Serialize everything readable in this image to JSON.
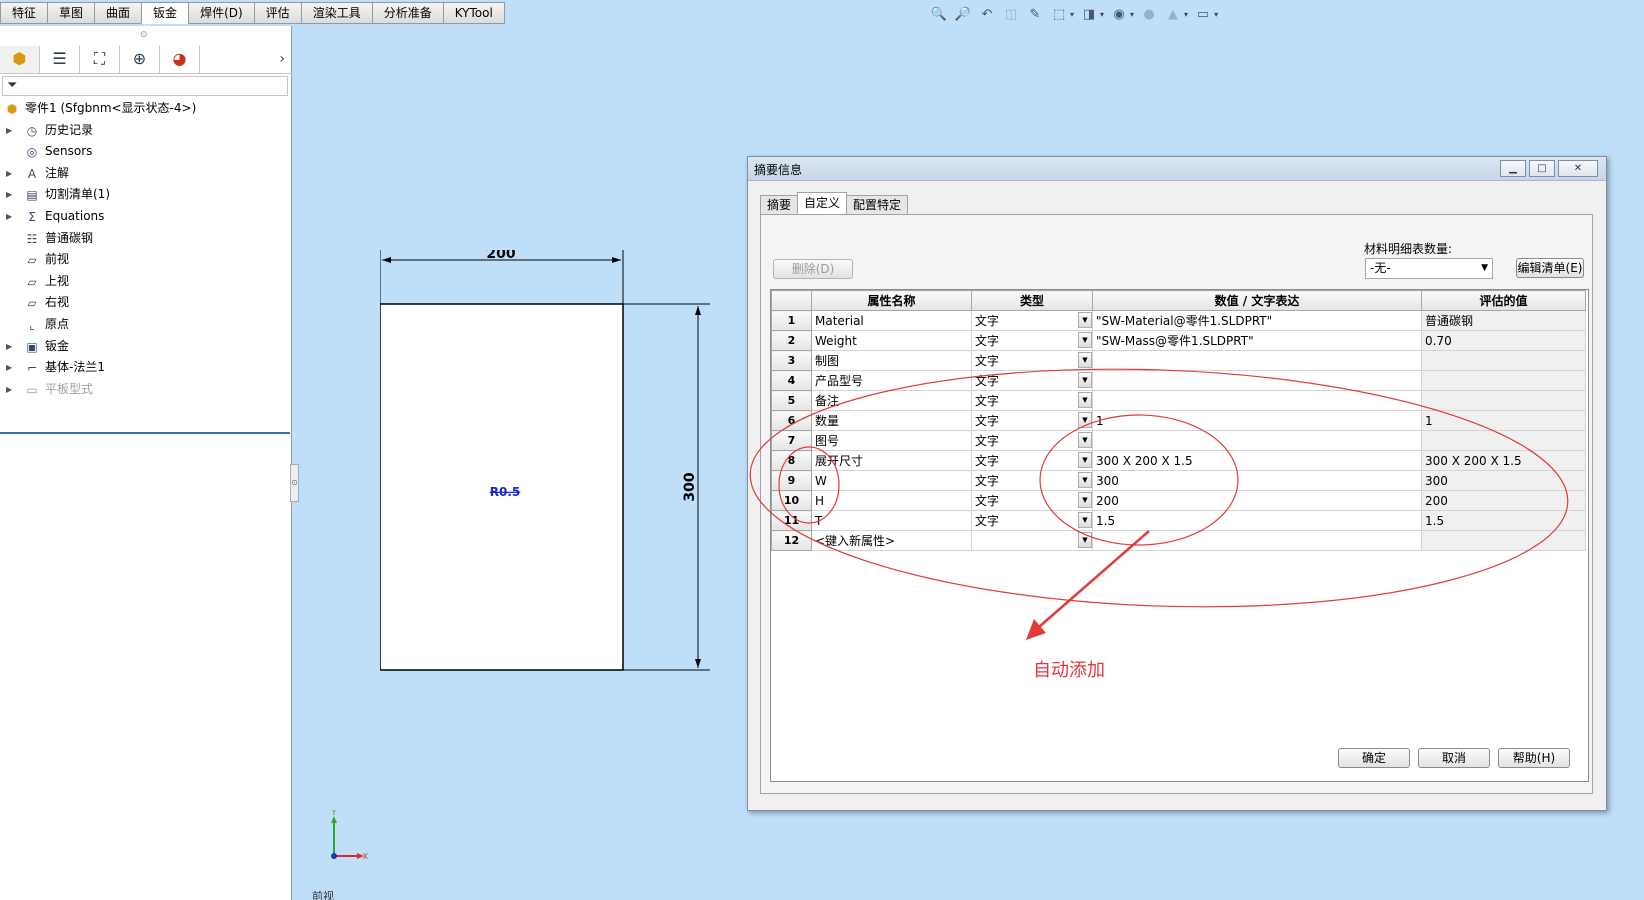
{
  "tabs": [
    "特征",
    "草图",
    "曲面",
    "钣金",
    "焊件(D)",
    "评估",
    "渲染工具",
    "分析准备",
    "KYTool"
  ],
  "active_tab": "钣金",
  "head_icons": [
    "zoom-to-fit-icon",
    "zoom-area-icon",
    "previous-view-icon",
    "section-view-icon",
    "dynamic-annotation-icon",
    "view-orientation-icon",
    "display-style-icon",
    "hide-show-icon",
    "appearance-icon",
    "scene-icon",
    "monitor-icon"
  ],
  "left_panel": {
    "tab_icons": [
      "feature-manager-icon",
      "property-manager-icon",
      "configuration-manager-icon",
      "dimxpert-icon",
      "display-manager-icon"
    ],
    "tree": [
      {
        "label": "零件1  (Sfgbnm<显示状态-4>)",
        "icon": "part-icon",
        "expandable": false,
        "indent": 0
      },
      {
        "label": "历史记录",
        "icon": "history-icon",
        "expandable": true,
        "indent": 1
      },
      {
        "label": "Sensors",
        "icon": "sensor-icon",
        "expandable": false,
        "indent": 1
      },
      {
        "label": "注解",
        "icon": "annotation-icon",
        "expandable": true,
        "indent": 1
      },
      {
        "label": "切割清单(1)",
        "icon": "cut-list-icon",
        "expandable": true,
        "indent": 1
      },
      {
        "label": "Equations",
        "icon": "equations-icon",
        "expandable": true,
        "indent": 1
      },
      {
        "label": "普通碳钢",
        "icon": "material-icon",
        "expandable": false,
        "indent": 1
      },
      {
        "label": "前视",
        "icon": "plane-icon",
        "expandable": false,
        "indent": 1
      },
      {
        "label": "上视",
        "icon": "plane-icon",
        "expandable": false,
        "indent": 1
      },
      {
        "label": "右视",
        "icon": "plane-icon",
        "expandable": false,
        "indent": 1
      },
      {
        "label": "原点",
        "icon": "origin-icon",
        "expandable": false,
        "indent": 1
      },
      {
        "label": "钣金",
        "icon": "sheet-metal-icon",
        "expandable": true,
        "indent": 1
      },
      {
        "label": "基体-法兰1",
        "icon": "base-flange-icon",
        "expandable": true,
        "indent": 1
      },
      {
        "label": "平板型式",
        "icon": "flat-pattern-icon",
        "expandable": true,
        "indent": 1,
        "disabled": true
      }
    ]
  },
  "drawing": {
    "width_dim": "200",
    "height_dim": "300",
    "radius_note": "R0.5"
  },
  "triad": {
    "y": "Y",
    "x": "X"
  },
  "view_label": "前视",
  "dialog": {
    "title": "摘要信息",
    "tabs": [
      "摘要",
      "自定义",
      "配置特定"
    ],
    "active_tab": "自定义",
    "delete_button": "删除(D)",
    "bom_qty_label": "材料明细表数量:",
    "bom_qty_value": "-无-",
    "edit_list_button": "编辑清单(E)",
    "columns": [
      "",
      "属性名称",
      "类型",
      "数值 / 文字表达",
      "评估的值"
    ],
    "rows": [
      {
        "no": "1",
        "name": "Material",
        "type": "文字",
        "value": "\"SW-Material@零件1.SLDPRT\"",
        "evaluated": "普通碳钢"
      },
      {
        "no": "2",
        "name": "Weight",
        "type": "文字",
        "value": "\"SW-Mass@零件1.SLDPRT\"",
        "evaluated": "0.70"
      },
      {
        "no": "3",
        "name": "制图",
        "type": "文字",
        "value": "",
        "evaluated": ""
      },
      {
        "no": "4",
        "name": "产品型号",
        "type": "文字",
        "value": "",
        "evaluated": ""
      },
      {
        "no": "5",
        "name": "备注",
        "type": "文字",
        "value": "",
        "evaluated": ""
      },
      {
        "no": "6",
        "name": "数量",
        "type": "文字",
        "value": "1",
        "evaluated": "1"
      },
      {
        "no": "7",
        "name": "图号",
        "type": "文字",
        "value": "",
        "evaluated": ""
      },
      {
        "no": "8",
        "name": "展开尺寸",
        "type": "文字",
        "value": "300 X 200 X 1.5",
        "evaluated": "300 X 200 X 1.5"
      },
      {
        "no": "9",
        "name": "W",
        "type": "文字",
        "value": "300",
        "evaluated": "300"
      },
      {
        "no": "10",
        "name": "H",
        "type": "文字",
        "value": "200",
        "evaluated": "200"
      },
      {
        "no": "11",
        "name": "T",
        "type": "文字",
        "value": "1.5",
        "evaluated": "1.5"
      },
      {
        "no": "12",
        "name": "<键入新属性>",
        "type": "",
        "value": "",
        "evaluated": ""
      }
    ],
    "ok_button": "确定",
    "cancel_button": "取消",
    "help_button": "帮助(H)"
  },
  "annotation": {
    "text": "自动添加",
    "color": "#e0373f"
  }
}
